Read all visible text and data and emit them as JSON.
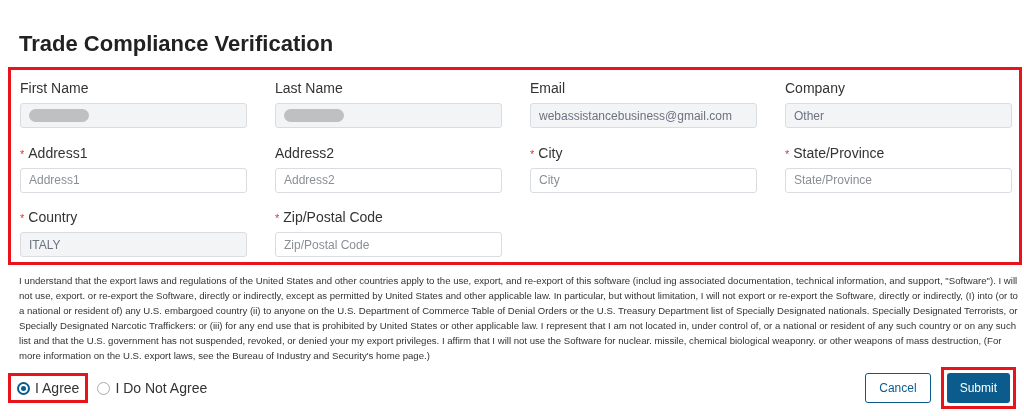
{
  "title": "Trade Compliance Verification",
  "form": {
    "highlighted": true,
    "fields": [
      {
        "label": "First Name",
        "required": false,
        "disabled": true,
        "redacted": true
      },
      {
        "label": "Last Name",
        "required": false,
        "disabled": true,
        "redacted": true
      },
      {
        "label": "Email",
        "required": false,
        "disabled": true,
        "value": "webassistancebusiness@gmail.com"
      },
      {
        "label": "Company",
        "required": false,
        "disabled": true,
        "value": "Other"
      },
      {
        "label": "Address1",
        "required": true,
        "disabled": false,
        "placeholder": "Address1"
      },
      {
        "label": "Address2",
        "required": false,
        "disabled": false,
        "placeholder": "Address2"
      },
      {
        "label": "City",
        "required": true,
        "disabled": false,
        "placeholder": "City"
      },
      {
        "label": "State/Province",
        "required": true,
        "disabled": false,
        "placeholder": "State/Province"
      },
      {
        "label": "Country",
        "required": true,
        "disabled": true,
        "value": "ITALY"
      },
      {
        "label": "Zip/Postal Code",
        "required": true,
        "disabled": false,
        "placeholder": "Zip/Postal Code"
      }
    ],
    "required_mark": "*"
  },
  "agreement_text": "I understand that the export laws and regulations of the United States and other countries apply to the use, export, and re-export of this software (includ ing associated documentation, technical information, and support, \"Software\"). I will not use, export. or re-export the Software, directly or indirectly, except as permitted by United States and other applicable law. In particular, but without limitation, I will not export or re-export the Software, directly or indirectly, (I) into (or to a national or resident of) any U.S. embargoed country (ii) to anyone on the U.S. Department of Commerce Table of Denial Orders or the U.S. Treasury Department list of Specially Designated nationals. Specially Designated Terrorists, or Specially Designated Narcotic Traffickers: or (iii) for any end use that is prohibited by United States or other applicable law. I represent that I am not located in, under control of, or a national or resident of any such country or on any such list and that the U.S. government has not suspended, revoked, or denied your my export privileges. I affirm that I will not use the Software for nuclear. missile, chemical biological weaponry. or other weapons of mass destruction, (For more information on the U.S. export laws, see the Bureau of Industry and Security's home page.)",
  "choices": [
    {
      "label": "I Agree",
      "selected": true,
      "highlighted": true
    },
    {
      "label": "I Do Not Agree",
      "selected": false,
      "highlighted": false
    }
  ],
  "buttons": [
    {
      "label": "Cancel",
      "kind": "secondary",
      "highlighted": false
    },
    {
      "label": "Submit",
      "kind": "primary",
      "highlighted": true
    }
  ]
}
